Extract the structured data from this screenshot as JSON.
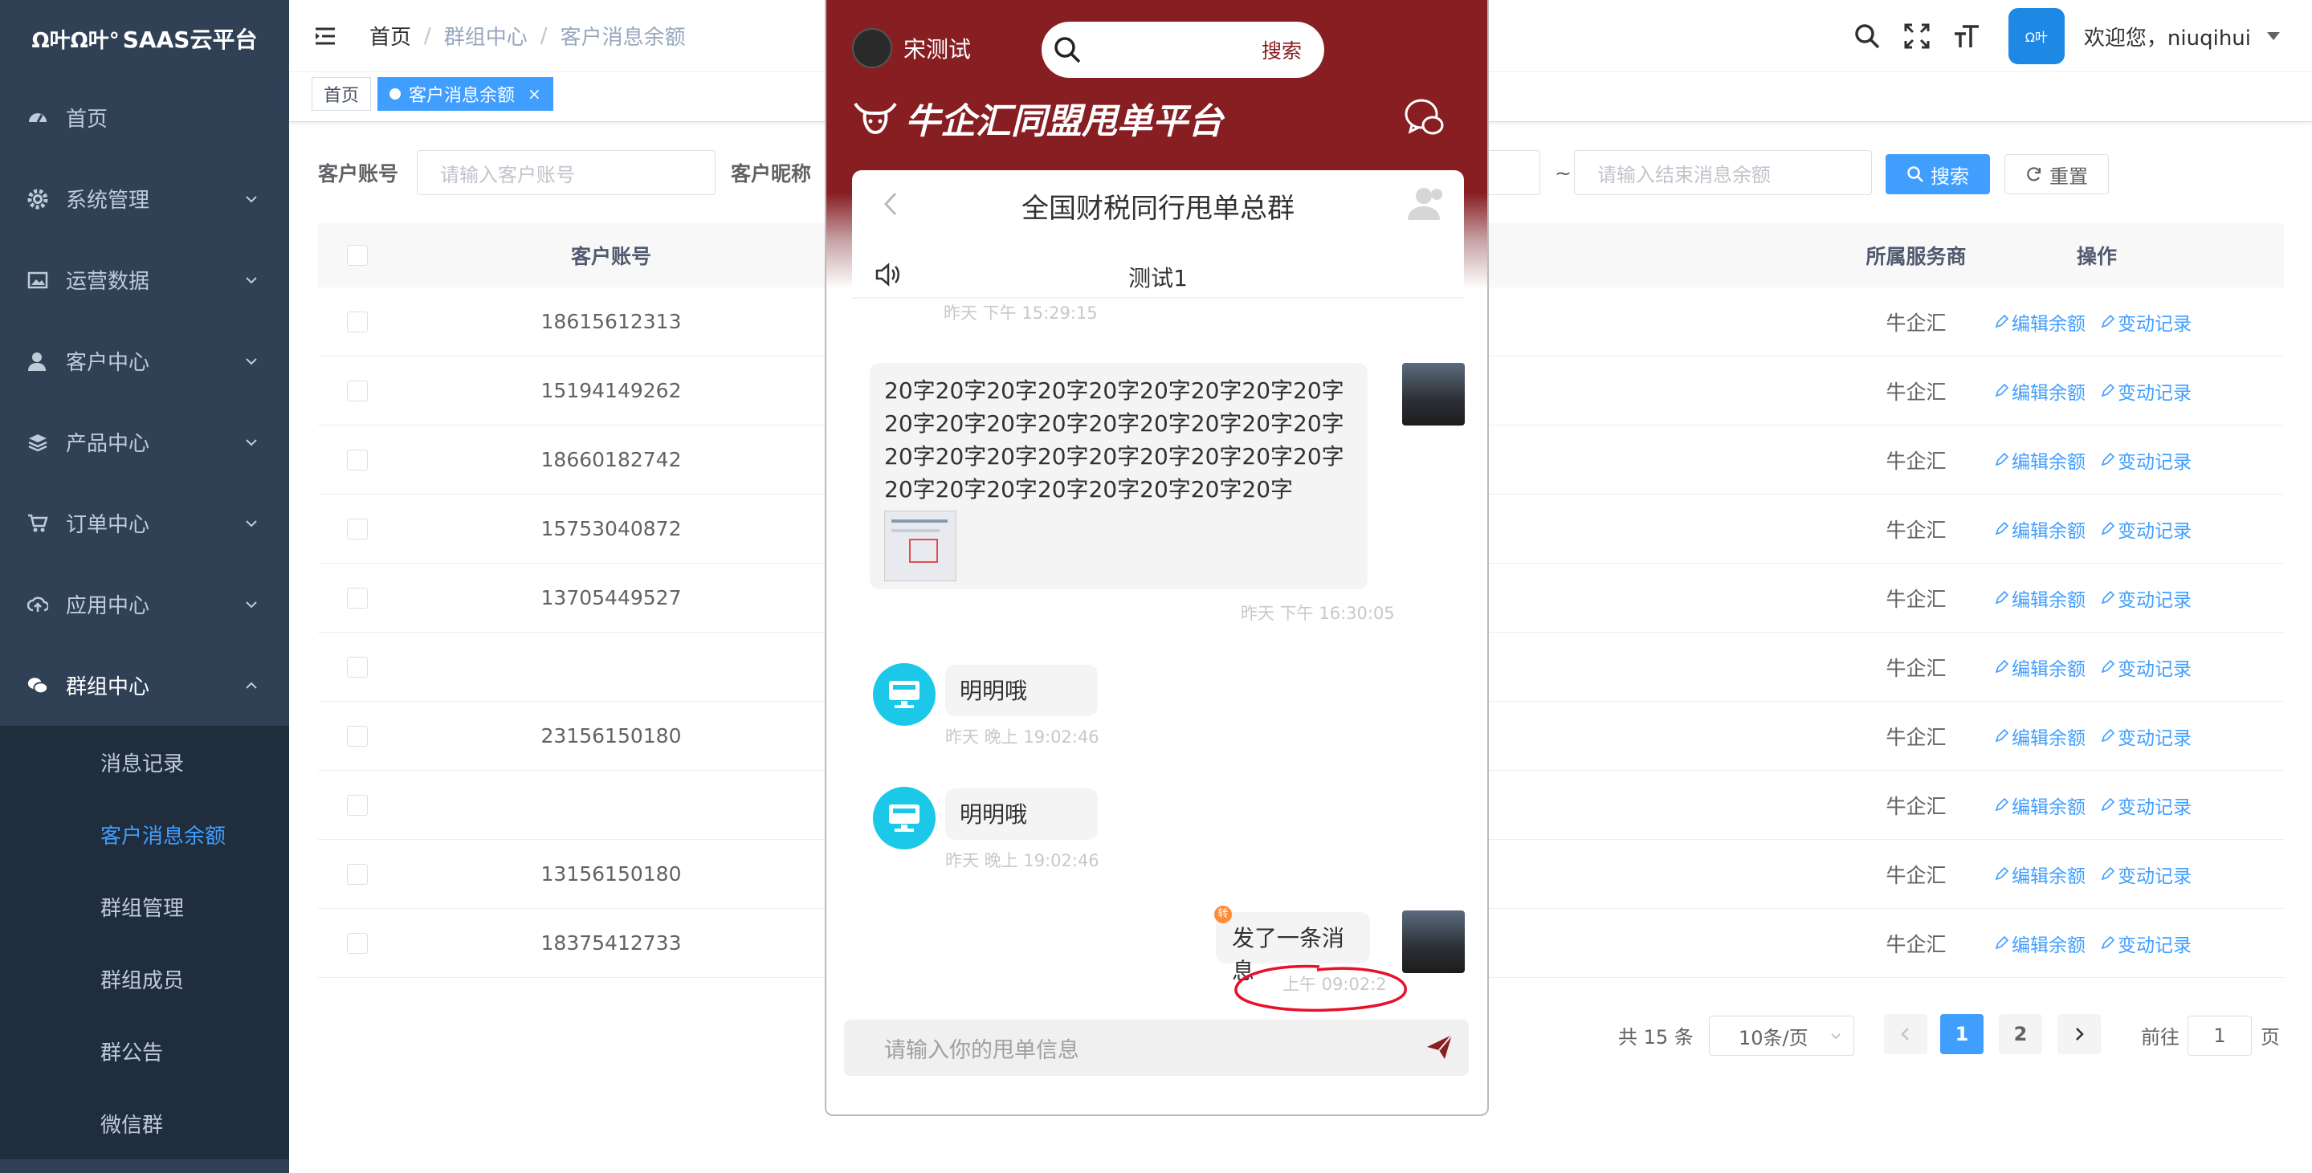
{
  "app": {
    "logo_text": "SAAS云平台"
  },
  "sidebar": {
    "items": [
      {
        "label": "首页",
        "icon": "dashboard-icon"
      },
      {
        "label": "系统管理",
        "icon": "gear-icon"
      },
      {
        "label": "运营数据",
        "icon": "image-icon"
      },
      {
        "label": "客户中心",
        "icon": "user-icon"
      },
      {
        "label": "产品中心",
        "icon": "layers-icon"
      },
      {
        "label": "订单中心",
        "icon": "cart-icon"
      },
      {
        "label": "应用中心",
        "icon": "cloud-upload-icon"
      },
      {
        "label": "群组中心",
        "icon": "wechat-icon"
      }
    ],
    "sub_items": [
      "消息记录",
      "客户消息余额",
      "群组管理",
      "群组成员",
      "群公告",
      "微信群"
    ],
    "active_sub": "客户消息余额"
  },
  "header": {
    "breadcrumb": [
      "首页",
      "群组中心",
      "客户消息余额"
    ],
    "avatar_text": "Ω叶",
    "welcome": "欢迎您，niuqihui"
  },
  "tags": {
    "home": "首页",
    "active": "客户消息余额",
    "close": "×"
  },
  "filters": {
    "account_label": "客户账号",
    "account_placeholder": "请输入客户账号",
    "nickname_label": "客户昵称",
    "range_sep": "~",
    "end_placeholder": "请输入结束消息余额",
    "search_btn": "搜索",
    "reset_btn": "重置"
  },
  "table": {
    "columns": {
      "account": "客户账号",
      "provider": "所属服务商",
      "actions": "操作"
    },
    "edit_label": "编辑余额",
    "log_label": "变动记录",
    "rows": [
      {
        "account": "18615612313",
        "provider": "牛企汇"
      },
      {
        "account": "15194149262",
        "provider": "牛企汇"
      },
      {
        "account": "18660182742",
        "provider": "牛企汇"
      },
      {
        "account": "15753040872",
        "provider": "牛企汇"
      },
      {
        "account": "13705449527",
        "provider": "牛企汇"
      },
      {
        "account": "",
        "provider": "牛企汇"
      },
      {
        "account": "23156150180",
        "provider": "牛企汇"
      },
      {
        "account": "",
        "provider": "牛企汇"
      },
      {
        "account": "13156150180",
        "provider": "牛企汇"
      },
      {
        "account": "18375412733",
        "provider": "牛企汇"
      }
    ]
  },
  "pagination": {
    "total": "共 15 条",
    "page_size": "10条/页",
    "pages": [
      "1",
      "2"
    ],
    "current": "1",
    "goto_label": "前往",
    "goto_value": "1",
    "page_suffix": "页"
  },
  "phone": {
    "user_name": "宋测试",
    "search_label": "搜索",
    "brand": "牛企汇同盟甩单平台",
    "group_title": "全国财税同行甩单总群",
    "notice": "测试1",
    "messages": {
      "ts0": "昨天 下午 15:29:15",
      "long_text": "20字20字20字20字20字20字20字20字20字20字20字20字20字20字20字20字20字20字20字20字20字20字20字20字20字20字20字20字20字20字20字20字20字20字20字",
      "ts1": "昨天 下午 16:30:05",
      "m2": "明明哦",
      "ts2": "昨天 晚上 19:02:46",
      "m3": "明明哦",
      "ts3": "昨天 晚上 19:02:46",
      "m4": "发了一条消息",
      "badge": "转",
      "ts4": "上午 09:02:2"
    },
    "input_placeholder": "请输入你的甩单信息"
  },
  "colors": {
    "sidebar": "#304156",
    "primary": "#409eff",
    "brand_red": "#871e22",
    "annotation": "#e8102a"
  }
}
